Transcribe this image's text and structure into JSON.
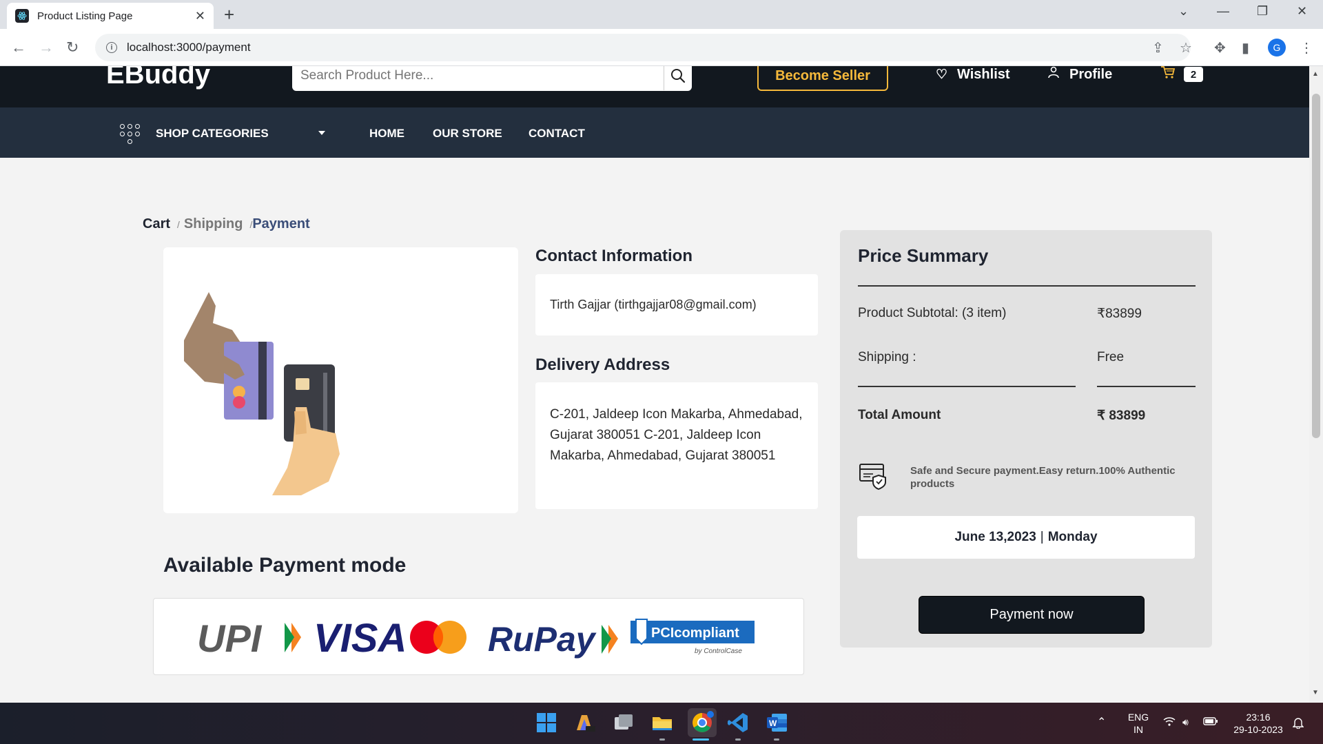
{
  "browser": {
    "tab_title": "Product Listing Page",
    "url": "localhost:3000/payment",
    "profile_initial": "G"
  },
  "header": {
    "logo": "EBuddy",
    "search_placeholder": "Search Product Here...",
    "become_seller": "Become Seller",
    "wishlist": "Wishlist",
    "profile": "Profile",
    "cart_count": "2",
    "accent_color": "#f6b93b"
  },
  "nav": {
    "categories": "SHOP CATEGORIES",
    "home": "HOME",
    "store": "OUR STORE",
    "contact": "CONTACT"
  },
  "breadcrumb": {
    "cart": "Cart",
    "sep1": "/",
    "shipping": "Shipping",
    "sep2": "/",
    "payment": "Payment"
  },
  "contact": {
    "title": "Contact Information",
    "value": "Tirth Gajjar (tirthgajjar08@gmail.com)"
  },
  "delivery": {
    "title": "Delivery Address",
    "value": "C-201, Jaldeep Icon Makarba, Ahmedabad, Gujarat 380051 C-201, Jaldeep Icon Makarba, Ahmedabad, Gujarat 380051"
  },
  "summary": {
    "title": "Price Summary",
    "subtotal_label": "Product Subtotal: (3 item)",
    "subtotal_value": "₹83899",
    "shipping_label": "Shipping :",
    "shipping_value": "Free",
    "total_label": "Total Amount",
    "total_value": "₹ 83899",
    "secure_text": "Safe and Secure payment.Easy return.100% Authentic products",
    "date": "June 13,2023",
    "date_sep": "|",
    "day": "Monday",
    "pay_button": "Payment now"
  },
  "payment_modes": {
    "title": "Available Payment mode",
    "upi": "UPI",
    "visa": "VISA",
    "rupay": "RuPay",
    "pci": "PCIcompliant",
    "pci_sub": "by ControlCase"
  },
  "taskbar": {
    "lang_top": "ENG",
    "lang_bottom": "IN",
    "time": "23:16",
    "date": "29-10-2023"
  },
  "icons": [
    "heart-icon",
    "user-icon",
    "cart-icon",
    "search-icon",
    "grid-dots-icon",
    "shield-card-icon"
  ]
}
